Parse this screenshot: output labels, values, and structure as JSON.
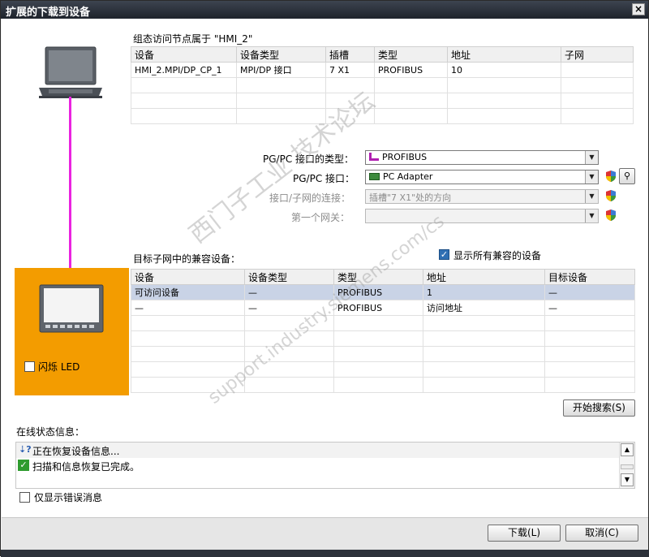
{
  "window": {
    "title": "扩展的下载到设备",
    "close_label": "×"
  },
  "configured_access": {
    "heading": "组态访问节点属于 \"HMI_2\"",
    "columns": [
      "设备",
      "设备类型",
      "插槽",
      "类型",
      "地址",
      "子网"
    ],
    "rows": [
      [
        "HMI_2.MPI/DP_CP_1",
        "MPI/DP 接口",
        "7 X1",
        "PROFIBUS",
        "10",
        ""
      ]
    ]
  },
  "interface": {
    "type_label": "PG/PC 接口的类型：",
    "type_value": "PROFIBUS",
    "iface_label": "PG/PC 接口：",
    "iface_value": "PC Adapter",
    "conn_label": "接口/子网的连接：",
    "conn_value": "插槽\"7 X1\"处的方向",
    "gateway_label": "第一个网关：",
    "gateway_value": ""
  },
  "target": {
    "heading": "目标子网中的兼容设备：",
    "show_all_label": "显示所有兼容的设备",
    "show_all_checked": true,
    "columns": [
      "设备",
      "设备类型",
      "类型",
      "地址",
      "目标设备"
    ],
    "rows": [
      [
        "可访问设备",
        "—",
        "PROFIBUS",
        "1",
        "—"
      ],
      [
        "—",
        "—",
        "PROFIBUS",
        "访问地址",
        "—"
      ]
    ],
    "flash_led_label": "闪烁 LED",
    "start_search_label": "开始搜索(S)"
  },
  "online_status": {
    "heading": "在线状态信息：",
    "messages": [
      {
        "icon": "progress-icon",
        "text": "正在恢复设备信息..."
      },
      {
        "icon": "check-icon",
        "text": "扫描和信息恢复已完成。"
      }
    ],
    "only_errors_label": "仅显示错误消息"
  },
  "footer": {
    "download_label": "下载(L)",
    "cancel_label": "取消(C)"
  },
  "watermark": {
    "line1": "西门子工业  技术论坛",
    "line2": "support.industry.siemens.com/cs"
  },
  "colors": {
    "highlight_orange": "#f39c00",
    "connection_line": "#ea22e0",
    "selected_row": "#c9d3e6"
  }
}
